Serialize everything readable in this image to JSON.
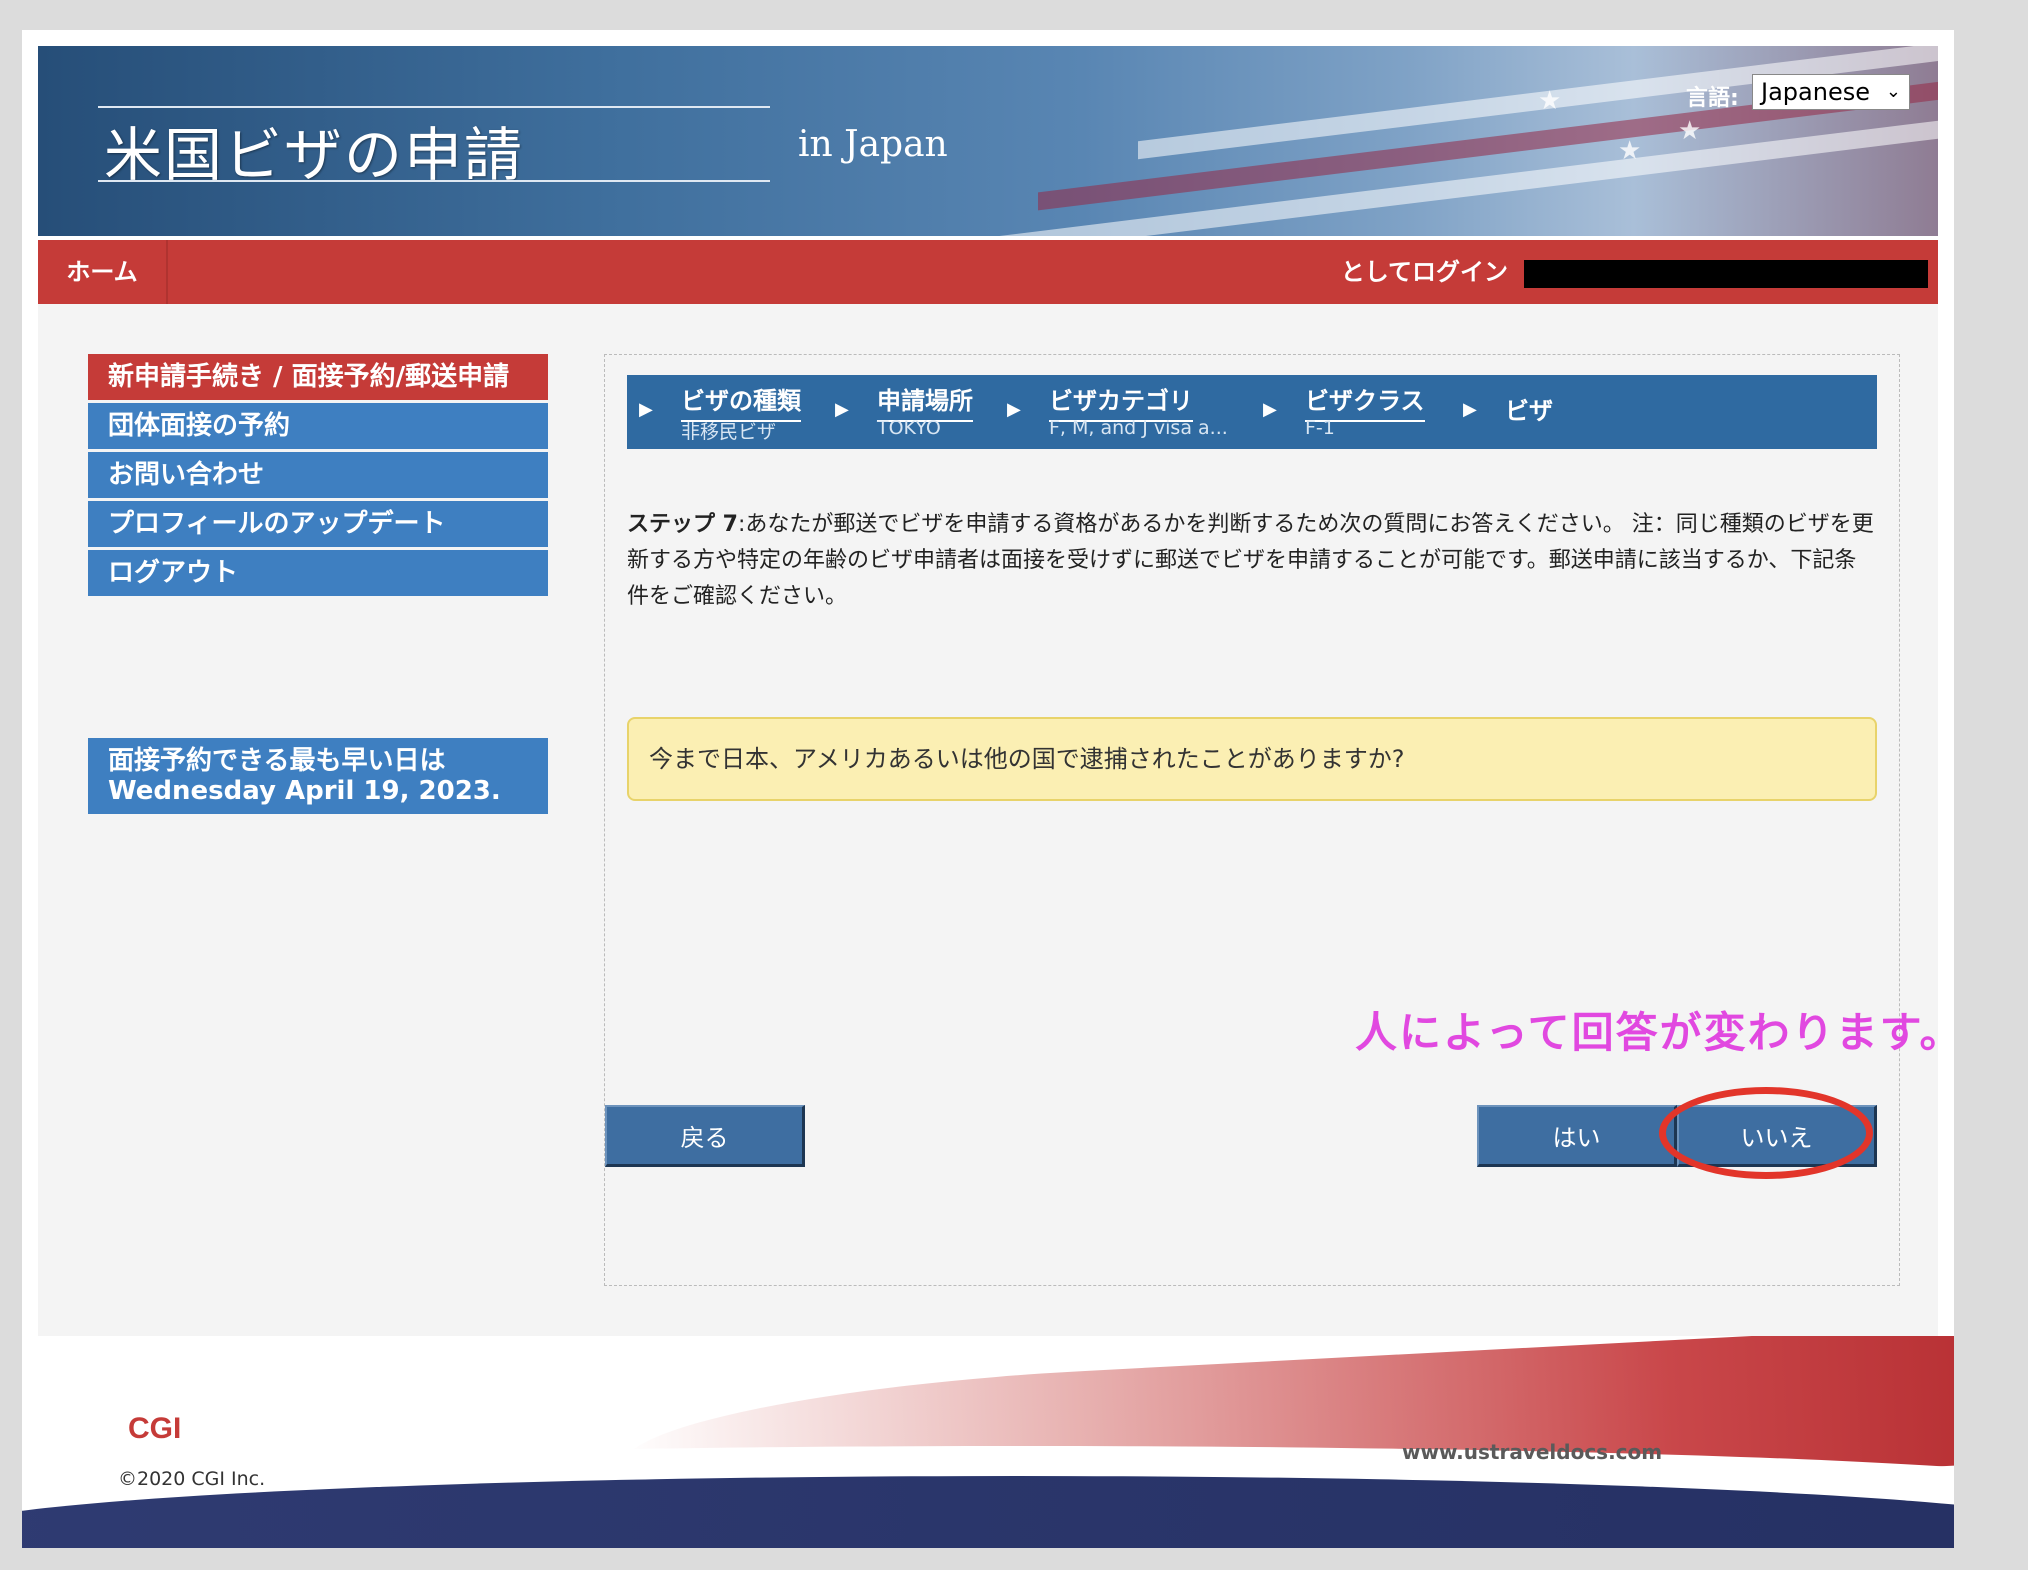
{
  "header": {
    "site_title": "米国ビザの申請",
    "site_subtitle": "in  Japan",
    "language_label": "言語:",
    "language_value": "Japanese"
  },
  "navbar": {
    "home": "ホーム",
    "login_text": "としてログイン"
  },
  "sidebar": {
    "items": [
      {
        "label": "新申請手続き / 面接予約/郵送申請"
      },
      {
        "label": "団体面接の予約"
      },
      {
        "label": "お問い合わせ"
      },
      {
        "label": "プロフィールのアップデート"
      },
      {
        "label": "ログアウト"
      }
    ],
    "earliest_line1": "面接予約できる最も早い日は",
    "earliest_line2": "Wednesday April 19, 2023."
  },
  "steps": [
    {
      "label": "ビザの種類",
      "value": "非移民ビザ"
    },
    {
      "label": "申請場所",
      "value": "TOKYO"
    },
    {
      "label": "ビザカテゴリ",
      "value": "F, M, and J visa a..."
    },
    {
      "label": "ビザクラス",
      "value": "F-1"
    },
    {
      "label": "ビザ",
      "value": ""
    }
  ],
  "main": {
    "step_prefix": "ステップ 7",
    "step_text": ":あなたが郵送でビザを申請する資格があるかを判断するため次の質問にお答えください。 注：同じ種類のビザを更新する方や特定の年齢のビザ申請者は面接を受けずに郵送でビザを申請することが可能です。郵送申請に該当するか、下記条件をご確認ください。",
    "question": "今まで日本、アメリカあるいは他の国で逮捕されたことがありますか?",
    "annotation": "人によって回答が変わります。",
    "back_button": "戻る",
    "yes_button": "はい",
    "no_button": "いいえ"
  },
  "footer": {
    "logo": "CGI",
    "copyright": "©2020 CGI Inc.",
    "url": "www.ustraveldocs.com"
  },
  "colors": {
    "nav_red": "#c53b38",
    "sidebar_blue": "#3e7fc1",
    "step_bar_blue": "#2f6aa1",
    "button_blue": "#3e6ea1",
    "question_bg": "#fbefb3",
    "annotation_pink": "#e148e0",
    "annotation_circle": "#e2352a"
  }
}
